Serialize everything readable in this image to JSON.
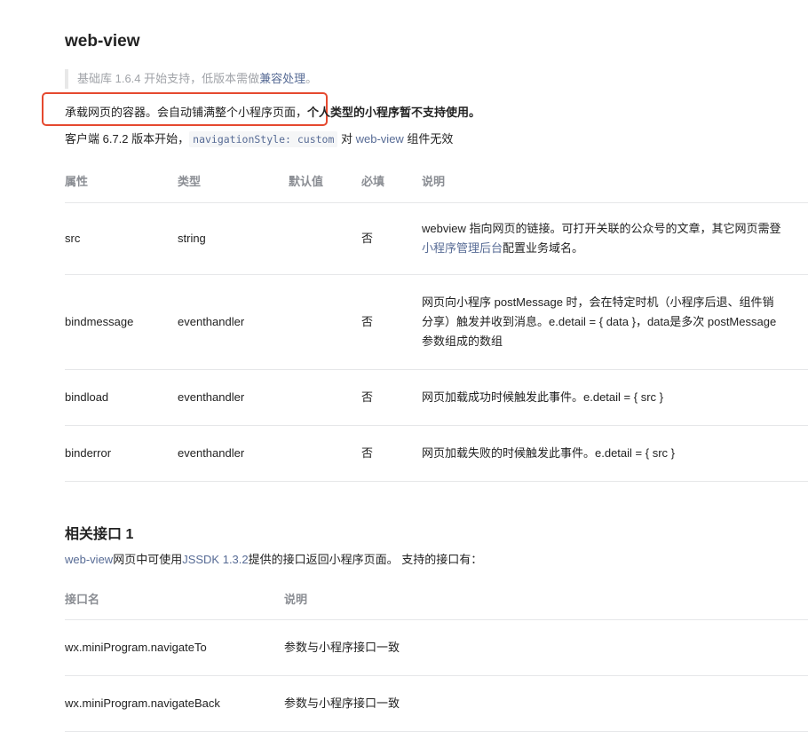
{
  "header": {
    "title": "web-view"
  },
  "note": {
    "prefix": "基础库 1.6.4 开始支持，低版本需做",
    "link": "兼容处理",
    "suffix": "。"
  },
  "description": {
    "line1_plain": "承载网页的容器。会自动铺满整个小程序页面，",
    "line1_bold": "个人类型的小程序暂不支持使用。",
    "line2_prefix": "客户端 6.7.2 版本开始，",
    "line2_code": "navigationStyle: custom",
    "line2_mid": " 对 ",
    "line2_link": "web-view",
    "line2_suffix": " 组件无效"
  },
  "attr_table": {
    "headers": [
      "属性",
      "类型",
      "默认值",
      "必填",
      "说明"
    ],
    "rows": [
      {
        "name": "src",
        "type": "string",
        "default": "",
        "required": "否",
        "desc": "webview 指向网页的链接。可打开关联的公众号的文章，其它网页需登",
        "desc_link": "小程序管理后台",
        "desc_suffix": "配置业务域名。"
      },
      {
        "name": "bindmessage",
        "type": "eventhandler",
        "default": "",
        "required": "否",
        "desc_line1": "网页向小程序 postMessage 时，会在特定时机（小程序后退、组件销",
        "desc_line2": "分享）触发并收到消息。e.detail = { data }，data是多次 postMessage",
        "desc_line3": "参数组成的数组"
      },
      {
        "name": "bindload",
        "type": "eventhandler",
        "default": "",
        "required": "否",
        "desc": "网页加载成功时候触发此事件。e.detail = { src }"
      },
      {
        "name": "binderror",
        "type": "eventhandler",
        "default": "",
        "required": "否",
        "desc": "网页加载失败的时候触发此事件。e.detail = { src }"
      }
    ]
  },
  "related": {
    "title": "相关接口 1",
    "desc_link1": "web-view",
    "desc_mid": "网页中可使用",
    "desc_link2": "JSSDK 1.3.2",
    "desc_suffix": "提供的接口返回小程序页面。 支持的接口有："
  },
  "api_table": {
    "headers": [
      "接口名",
      "说明"
    ],
    "rows": [
      {
        "name": "wx.miniProgram.navigateTo",
        "desc": "参数与小程序接口一致"
      },
      {
        "name": "wx.miniProgram.navigateBack",
        "desc": "参数与小程序接口一致"
      }
    ]
  },
  "colors": {
    "link": "#576b95",
    "highlight_border": "#e5492f",
    "header_text": "#8a8d93",
    "note_text": "#a0a3a8"
  }
}
